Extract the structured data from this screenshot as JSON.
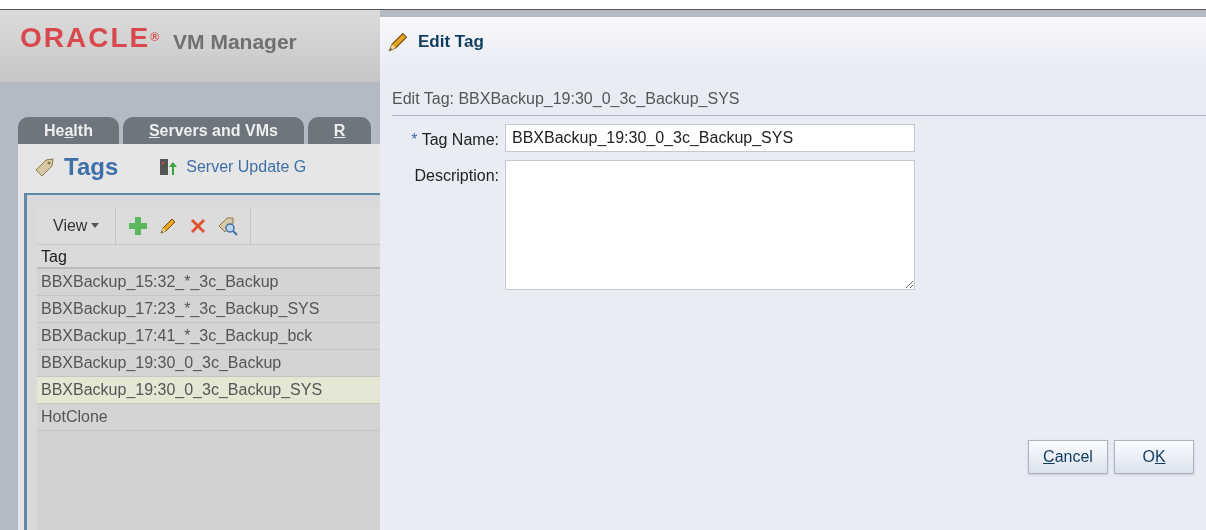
{
  "header": {
    "logo": "ORACLE",
    "logo_mark": "®",
    "product": "VM Manager"
  },
  "tabs": [
    {
      "parts": {
        "before": "He",
        "key": "a",
        "after": "lth"
      },
      "selected": false
    },
    {
      "parts": {
        "key": "S",
        "after": "ervers and VMs"
      },
      "selected": false
    },
    {
      "parts": {
        "key": "R"
      },
      "selected": false
    }
  ],
  "page": {
    "title": "Tags",
    "link": "Server Update G"
  },
  "toolbar": {
    "view": "View"
  },
  "table": {
    "columns": [
      "Tag"
    ],
    "rows": [
      {
        "tag": "BBXBackup_15:32_*_3c_Backup",
        "selected": false
      },
      {
        "tag": "BBXBackup_17:23_*_3c_Backup_SYS",
        "selected": false
      },
      {
        "tag": "BBXBackup_17:41_*_3c_Backup_bck",
        "selected": false
      },
      {
        "tag": "BBXBackup_19:30_0_3c_Backup",
        "selected": false
      },
      {
        "tag": "BBXBackup_19:30_0_3c_Backup_SYS",
        "selected": true
      },
      {
        "tag": "HotClone",
        "selected": false
      }
    ]
  },
  "dialog": {
    "title": "Edit Tag",
    "subtitle": "Edit Tag: BBXBackup_19:30_0_3c_Backup_SYS",
    "fields": [
      {
        "kind": "text",
        "label": "Tag Name:",
        "required_mark": "*",
        "value": "BBXBackup_19:30_0_3c_Backup_SYS"
      },
      {
        "kind": "textarea",
        "label": "Description:"
      }
    ],
    "buttons": [
      {
        "parts": {
          "key": "C",
          "after": "ancel"
        }
      },
      {
        "parts": {
          "before": "O",
          "key": "K"
        }
      }
    ]
  }
}
